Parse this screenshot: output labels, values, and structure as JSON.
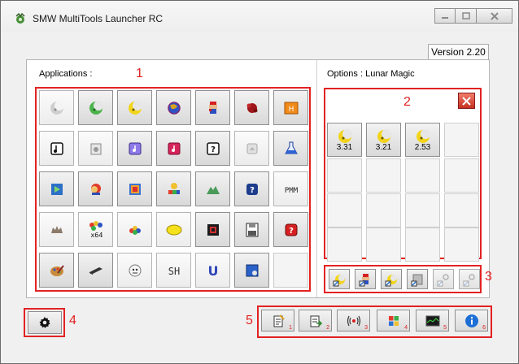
{
  "window": {
    "title": "SMW MultiTools Launcher RC",
    "version": "Version 2.20"
  },
  "applications": {
    "label": "Applications :",
    "marker": "1",
    "rows": [
      [
        "lunar-magic-gray-icon",
        "lunar-magic-green-icon",
        "lunar-magic-yellow-icon",
        "globe-icon",
        "mario-icon",
        "red-blob-icon",
        "hex-editor-icon"
      ],
      [
        "music-note-icon",
        "music-doc-icon",
        "music-purple-icon",
        "music-red-icon",
        "question-block-icon",
        "cloud-icon",
        "flask-icon"
      ],
      [
        "play-media-icon",
        "yoshi-icon",
        "palette-box-icon",
        "paint-tiles-icon",
        "mountain-icon",
        "question-blue-icon",
        "pmm-icon"
      ],
      [
        "koopa-icon",
        "x64-icon",
        "dots-icon",
        "yellow-oval-icon",
        "dark-chip-icon",
        "floppy-icon",
        "question-red-icon"
      ],
      [
        "paint-palette-icon",
        "memory-chip-icon",
        "boo-icon",
        "sh-icon",
        "u-letter-icon",
        "window-gear-icon",
        "empty"
      ]
    ],
    "texts": {
      "x64": "x64",
      "pmm": "PMM",
      "sh": "SH",
      "u": "U"
    }
  },
  "options": {
    "label": "Options : Lunar Magic",
    "marker": "2",
    "close_icon": "close-x-icon",
    "versions": [
      {
        "label": "3.31",
        "icon": "lunar-magic-yellow-icon"
      },
      {
        "label": "3.21",
        "icon": "lunar-magic-yellow-icon"
      },
      {
        "label": "2.53",
        "icon": "lunar-magic-yellow-icon"
      }
    ]
  },
  "tools_row": {
    "marker": "3",
    "icons": [
      "shortcut-moon-icon",
      "shortcut-mario-icon",
      "shortcut-moon-alt-icon",
      "shortcut-gray-icon",
      "shortcut-gear-icon",
      "shortcut-gear-alt-icon"
    ]
  },
  "settings": {
    "marker": "4",
    "icon": "gear-icon"
  },
  "bottom_bar": {
    "marker": "5",
    "buttons": [
      {
        "icon": "notes-icon",
        "num": "1"
      },
      {
        "icon": "document-arrow-icon",
        "num": "2"
      },
      {
        "icon": "broadcast-icon",
        "num": "3"
      },
      {
        "icon": "windows-logo-icon",
        "num": "4"
      },
      {
        "icon": "monitor-graph-icon",
        "num": "5"
      },
      {
        "icon": "info-icon",
        "num": "6"
      }
    ]
  },
  "colors": {
    "highlight": "#e22222",
    "accent_blue": "#1d6fd6"
  }
}
